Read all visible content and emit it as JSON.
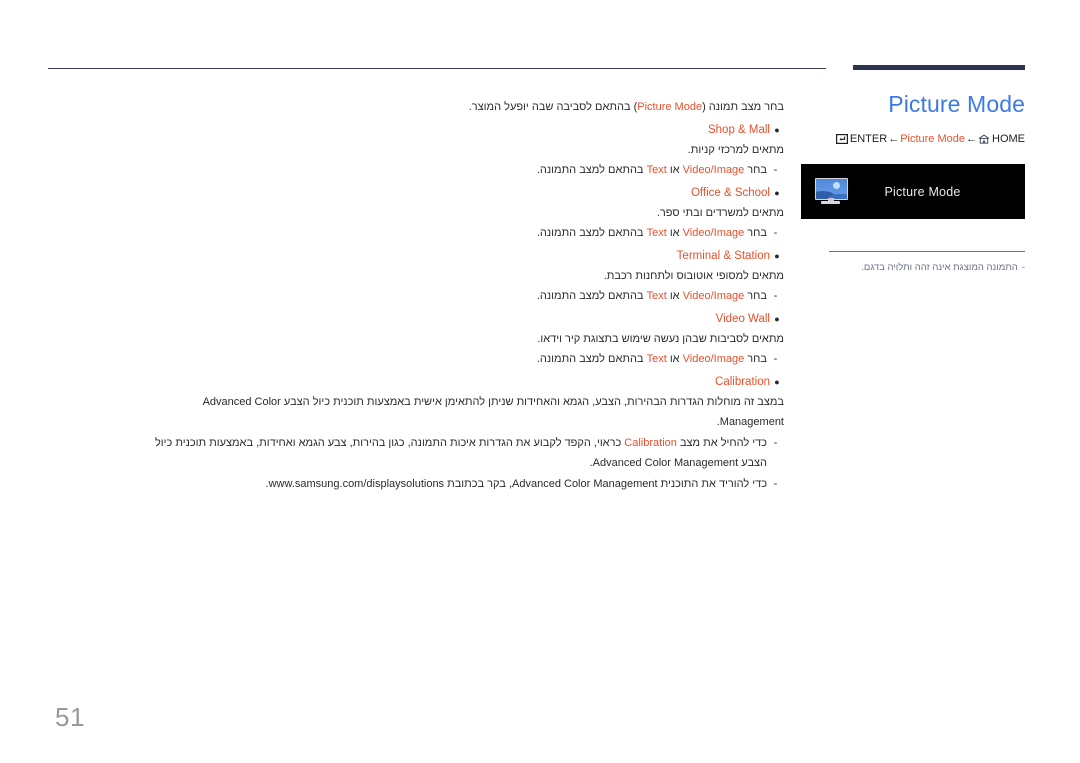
{
  "document": {
    "page_number": "51"
  },
  "header": {
    "title": "Picture Mode",
    "nav_path": {
      "home_label": "HOME",
      "arrow": "←",
      "middle_label": "Picture Mode",
      "enter_label": "ENTER"
    }
  },
  "osd_preview": {
    "label": "Picture Mode",
    "icon": "monitor-picture-icon",
    "note_marker": "-",
    "note": "התמונה המוצגת אינה זהה ותלויה בדגם."
  },
  "main": {
    "intro_before": "בחר מצב תמונה (",
    "intro_accent": "Picture Mode",
    "intro_after": ") בהתאם לסביבה שבה יופעל המוצר.",
    "bullet_glyph": "●",
    "dash_glyph": "-",
    "items": [
      {
        "title": "Shop & Mall",
        "desc": "מתאים למרכזי קניות.",
        "sub_before": "בחר ",
        "sub_accent1": "Video/Image",
        "sub_mid": " או ",
        "sub_accent2": "Text",
        "sub_after": " בהתאם למצב התמונה."
      },
      {
        "title": "Office & School",
        "desc": "מתאים למשרדים ובתי ספר.",
        "sub_before": "בחר ",
        "sub_accent1": "Video/Image",
        "sub_mid": " או ",
        "sub_accent2": "Text",
        "sub_after": " בהתאם למצב התמונה."
      },
      {
        "title": "Terminal & Station",
        "desc": "מתאים למסופי אוטובוס ולתחנות רכבת.",
        "sub_before": "בחר ",
        "sub_accent1": "Video/Image",
        "sub_mid": " או ",
        "sub_accent2": "Text",
        "sub_after": " בהתאם למצב התמונה."
      },
      {
        "title": "Video Wall",
        "desc": "מתאים לסביבות שבהן נעשה שימוש בתצוגת קיר וידאו.",
        "sub_before": "בחר ",
        "sub_accent1": "Video/Image",
        "sub_mid": " או ",
        "sub_accent2": "Text",
        "sub_after": " בהתאם למצב התמונה."
      }
    ],
    "calibration": {
      "title": "Calibration",
      "para_line1": "במצב זה מוחלות הגדרות הבהירות, הצבע, הגמא והאחידות שניתן להתאימן אישית באמצעות תוכנית כיול הצבע",
      "para_line2": "Advanced Color Management.",
      "sub1_a": "כדי להחיל את מצב ",
      "sub1_accent": "Calibration",
      "sub1_b": " כראוי, הקפד לקבוע את הגדרות איכות התמונה, כגון בהירות, צבע הגמא ואחידות, באמצעות",
      "sub1_c": "תוכנית כיול הצבע Advanced Color Management.",
      "sub2_a": "כדי להוריד את התוכנית ",
      "sub2_b": "Advanced Color Management",
      "sub2_c": ", בקר בכתובת ",
      "sub2_url": "www.samsung.com/displaysolutions."
    }
  },
  "colors": {
    "accent": "#e8502c",
    "title_blue": "#3d7ae8",
    "rule_navy": "#2e3350",
    "note_gray": "#6b7088",
    "page_num_gray": "#9a9a9a"
  }
}
